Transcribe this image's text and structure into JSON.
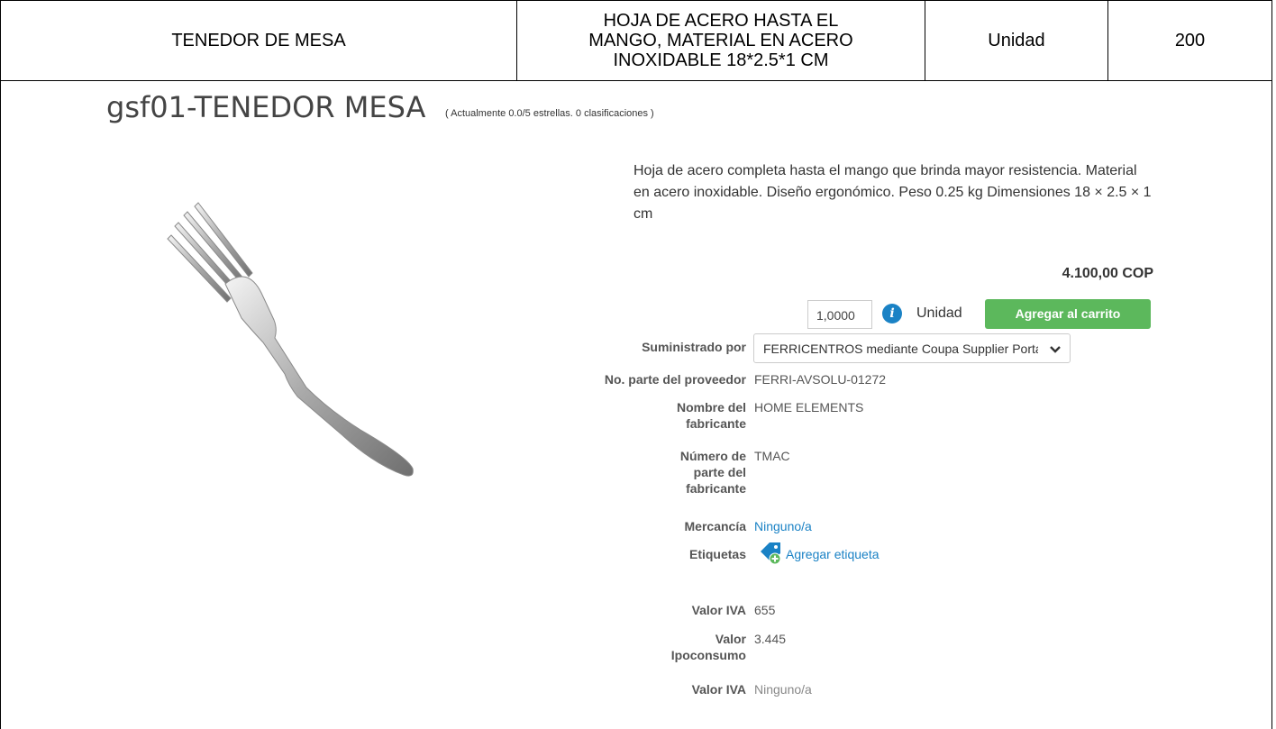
{
  "top_row": {
    "item": "TENEDOR DE MESA",
    "description_lines": [
      "HOJA DE ACERO HASTA EL",
      "MANGO, MATERIAL EN ACERO",
      "INOXIDABLE 18*2.5*1 CM"
    ],
    "unit": "Unidad",
    "quantity": "200"
  },
  "product": {
    "title": "gsf01-TENEDOR MESA",
    "rating": "( Actualmente 0.0/5 estrellas. 0 clasificaciones )",
    "description": "Hoja de acero completa hasta el mango que brinda mayor resistencia. Material en acero inoxidable. Diseño ergonómico. Peso 0.25 kg Dimensiones 18 × 2.5 × 1 cm",
    "price": "4.100,00 COP",
    "qty_value": "1,0000",
    "unit": "Unidad",
    "add_to_cart": "Agregar al carrito",
    "info_icon": "info-icon"
  },
  "details": {
    "supplier_label": "Suministrado por",
    "supplier_value": "FERRICENTROS mediante Coupa Supplier Portal",
    "supplier_part_label": "No. parte del proveedor",
    "supplier_part_value": "FERRI-AVSOLU-01272",
    "manufacturer_label_lines": [
      "Nombre del",
      "fabricante"
    ],
    "manufacturer_value": "HOME ELEMENTS",
    "mfr_part_label_lines": [
      "Número de",
      "parte del",
      "fabricante"
    ],
    "mfr_part_value": "TMAC",
    "commodity_label": "Mercancía",
    "commodity_value": "Ninguno/a",
    "tags_label": "Etiquetas",
    "tags_value": "Agregar etiqueta",
    "iva_label": "Valor IVA",
    "iva_value": "655",
    "ipoconsumo_label_lines": [
      "Valor",
      "Ipoconsumo"
    ],
    "ipoconsumo_value": "3.445",
    "iva2_label": "Valor IVA",
    "iva2_value": "Ninguno/a"
  },
  "colors": {
    "button_green": "#5cb85c",
    "link_blue": "#1a82c5"
  }
}
